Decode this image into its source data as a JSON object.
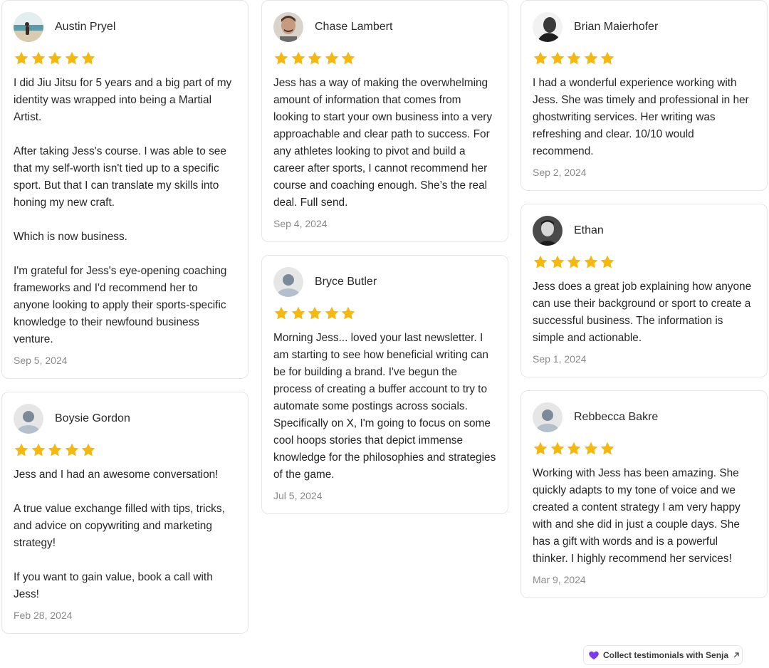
{
  "colors": {
    "star": "#f5b90e",
    "accent": "#7c3aed"
  },
  "reviews": [
    {
      "name": "Austin Pryel",
      "avatar": "beach-photo-avatar",
      "rating": 5,
      "paragraphs": [
        "I did Jiu Jitsu for 5 years and a big part of my identity was wrapped into being a Martial Artist.",
        "After taking Jess's course. I was able to see that my self-worth isn't tied up to a specific sport. But that I can translate my skills into honing my new craft.",
        "Which is now business.",
        "I'm grateful for Jess's eye-opening coaching frameworks and I'd recommend her to anyone looking to apply their sports-specific knowledge to their newfound business venture."
      ],
      "date": "Sep 5, 2024"
    },
    {
      "name": "Boysie Gordon",
      "avatar": "default-user-avatar",
      "rating": 5,
      "paragraphs": [
        "Jess and I had an awesome conversation!",
        "A true value exchange filled with tips, tricks, and advice on copywriting and marketing strategy!",
        "If you want to gain value, book a call with Jess!"
      ],
      "date": "Feb 28, 2024"
    },
    {
      "name": "Chase Lambert",
      "avatar": "portrait-photo-avatar",
      "rating": 5,
      "paragraphs": [
        "Jess has a way of making the overwhelming amount of information that comes from looking to start your own business into a very approachable and clear path to success. For any athletes looking to pivot and build a career after sports, I cannot recommend her course and coaching enough. She’s the real deal. Full send."
      ],
      "date": "Sep 4, 2024"
    },
    {
      "name": "Bryce Butler",
      "avatar": "default-user-avatar",
      "rating": 5,
      "paragraphs": [
        "Morning Jess... loved your last newsletter. I am starting to see how beneficial writing can be for building a brand. I've begun the process of creating a buffer account to try to automate some postings across socials. Specifically on X, I'm going to focus on some cool hoops stories that depict immense knowledge for the philosophies and strategies of the game."
      ],
      "date": "Jul 5, 2024"
    },
    {
      "name": "Brian Maierhofer",
      "avatar": "bw-photo-avatar",
      "rating": 5,
      "paragraphs": [
        "I had a wonderful experience working with Jess. She was timely and professional in her ghostwriting services. Her writing was refreshing and clear. 10/10 would recommend."
      ],
      "date": "Sep 2, 2024"
    },
    {
      "name": "Ethan",
      "avatar": "bw-photo-avatar",
      "rating": 5,
      "paragraphs": [
        "Jess does a great job explaining how anyone can use their background or sport to create a successful business. The information is simple and actionable."
      ],
      "date": "Sep 1, 2024"
    },
    {
      "name": "Rebbecca Bakre",
      "avatar": "default-user-avatar",
      "rating": 5,
      "paragraphs": [
        "Working with Jess has been amazing. She quickly adapts to my tone of voice and we created a content strategy I am very happy with and she did in just a couple days. She has a gift with words and is a powerful thinker. I highly recommend her services!"
      ],
      "date": "Mar 9, 2024"
    }
  ],
  "badge": {
    "label": "Collect testimonials with Senja",
    "icon": "heart-icon",
    "arrow_icon": "external-arrow-icon"
  }
}
